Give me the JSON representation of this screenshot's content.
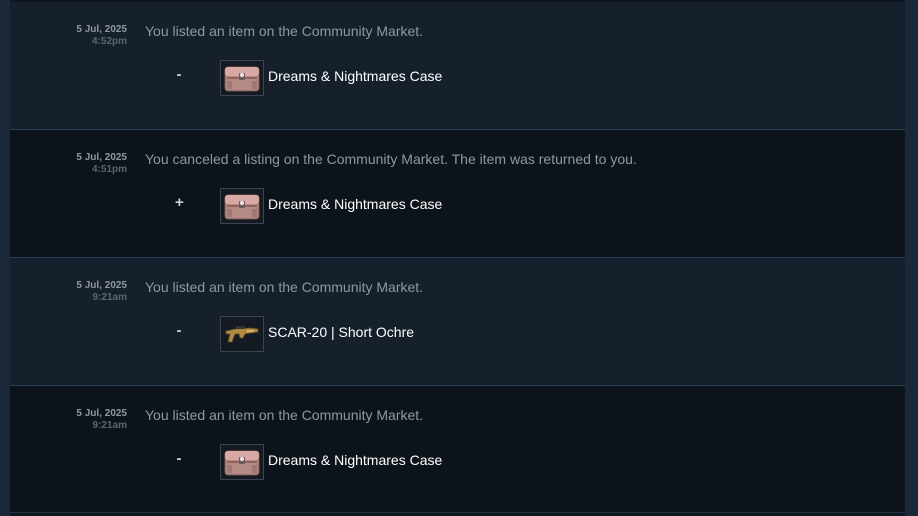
{
  "history": [
    {
      "date": "5 Jul, 2025",
      "time": "4:52pm",
      "description": "You listed an item on the Community Market.",
      "sign": "-",
      "item": {
        "name": "Dreams & Nightmares Case",
        "icon": "weapon-case-icon"
      }
    },
    {
      "date": "5 Jul, 2025",
      "time": "4:51pm",
      "description": "You canceled a listing on the Community Market. The item was returned to you.",
      "sign": "+",
      "item": {
        "name": "Dreams & Nightmares Case",
        "icon": "weapon-case-icon"
      }
    },
    {
      "date": "5 Jul, 2025",
      "time": "9:21am",
      "description": "You listed an item on the Community Market.",
      "sign": "-",
      "item": {
        "name": "SCAR-20 | Short Ochre",
        "icon": "rifle-icon"
      }
    },
    {
      "date": "5 Jul, 2025",
      "time": "9:21am",
      "description": "You listed an item on the Community Market.",
      "sign": "-",
      "item": {
        "name": "Dreams & Nightmares Case",
        "icon": "weapon-case-icon"
      }
    }
  ],
  "colors": {
    "background": "#1b2838",
    "row_light": "#16202d",
    "row_dark": "#0d131b",
    "text_muted": "#8f98a0",
    "text_item": "#ffffff"
  }
}
